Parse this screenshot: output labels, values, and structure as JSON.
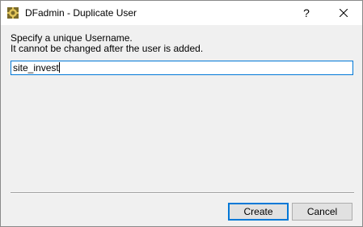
{
  "window": {
    "title": "DFadmin - Duplicate User",
    "app_icon": "dfadmin-gear-icon",
    "help_label": "?",
    "close_icon": "close-icon"
  },
  "prompt": {
    "line1": "Specify a unique Username.",
    "line2": "It cannot be changed after the user is added."
  },
  "username": {
    "value": "site_invest"
  },
  "buttons": {
    "create_label": "Create",
    "cancel_label": "Cancel"
  },
  "colors": {
    "focus_accent": "#0078d7",
    "dialog_background": "#f0f0f0",
    "button_face": "#e1e1e1"
  }
}
